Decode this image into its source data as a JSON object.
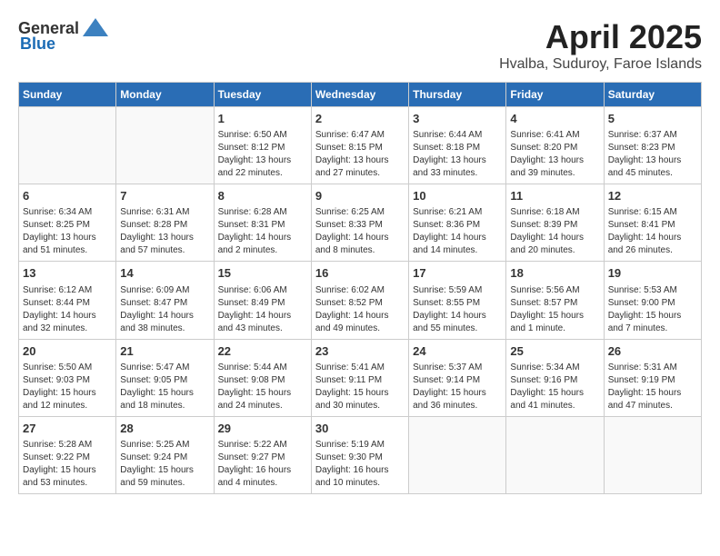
{
  "logo": {
    "general": "General",
    "blue": "Blue"
  },
  "title": "April 2025",
  "location": "Hvalba, Suduroy, Faroe Islands",
  "days_of_week": [
    "Sunday",
    "Monday",
    "Tuesday",
    "Wednesday",
    "Thursday",
    "Friday",
    "Saturday"
  ],
  "weeks": [
    [
      {
        "day": "",
        "sunrise": "",
        "sunset": "",
        "daylight": ""
      },
      {
        "day": "",
        "sunrise": "",
        "sunset": "",
        "daylight": ""
      },
      {
        "day": "1",
        "sunrise": "Sunrise: 6:50 AM",
        "sunset": "Sunset: 8:12 PM",
        "daylight": "Daylight: 13 hours and 22 minutes."
      },
      {
        "day": "2",
        "sunrise": "Sunrise: 6:47 AM",
        "sunset": "Sunset: 8:15 PM",
        "daylight": "Daylight: 13 hours and 27 minutes."
      },
      {
        "day": "3",
        "sunrise": "Sunrise: 6:44 AM",
        "sunset": "Sunset: 8:18 PM",
        "daylight": "Daylight: 13 hours and 33 minutes."
      },
      {
        "day": "4",
        "sunrise": "Sunrise: 6:41 AM",
        "sunset": "Sunset: 8:20 PM",
        "daylight": "Daylight: 13 hours and 39 minutes."
      },
      {
        "day": "5",
        "sunrise": "Sunrise: 6:37 AM",
        "sunset": "Sunset: 8:23 PM",
        "daylight": "Daylight: 13 hours and 45 minutes."
      }
    ],
    [
      {
        "day": "6",
        "sunrise": "Sunrise: 6:34 AM",
        "sunset": "Sunset: 8:25 PM",
        "daylight": "Daylight: 13 hours and 51 minutes."
      },
      {
        "day": "7",
        "sunrise": "Sunrise: 6:31 AM",
        "sunset": "Sunset: 8:28 PM",
        "daylight": "Daylight: 13 hours and 57 minutes."
      },
      {
        "day": "8",
        "sunrise": "Sunrise: 6:28 AM",
        "sunset": "Sunset: 8:31 PM",
        "daylight": "Daylight: 14 hours and 2 minutes."
      },
      {
        "day": "9",
        "sunrise": "Sunrise: 6:25 AM",
        "sunset": "Sunset: 8:33 PM",
        "daylight": "Daylight: 14 hours and 8 minutes."
      },
      {
        "day": "10",
        "sunrise": "Sunrise: 6:21 AM",
        "sunset": "Sunset: 8:36 PM",
        "daylight": "Daylight: 14 hours and 14 minutes."
      },
      {
        "day": "11",
        "sunrise": "Sunrise: 6:18 AM",
        "sunset": "Sunset: 8:39 PM",
        "daylight": "Daylight: 14 hours and 20 minutes."
      },
      {
        "day": "12",
        "sunrise": "Sunrise: 6:15 AM",
        "sunset": "Sunset: 8:41 PM",
        "daylight": "Daylight: 14 hours and 26 minutes."
      }
    ],
    [
      {
        "day": "13",
        "sunrise": "Sunrise: 6:12 AM",
        "sunset": "Sunset: 8:44 PM",
        "daylight": "Daylight: 14 hours and 32 minutes."
      },
      {
        "day": "14",
        "sunrise": "Sunrise: 6:09 AM",
        "sunset": "Sunset: 8:47 PM",
        "daylight": "Daylight: 14 hours and 38 minutes."
      },
      {
        "day": "15",
        "sunrise": "Sunrise: 6:06 AM",
        "sunset": "Sunset: 8:49 PM",
        "daylight": "Daylight: 14 hours and 43 minutes."
      },
      {
        "day": "16",
        "sunrise": "Sunrise: 6:02 AM",
        "sunset": "Sunset: 8:52 PM",
        "daylight": "Daylight: 14 hours and 49 minutes."
      },
      {
        "day": "17",
        "sunrise": "Sunrise: 5:59 AM",
        "sunset": "Sunset: 8:55 PM",
        "daylight": "Daylight: 14 hours and 55 minutes."
      },
      {
        "day": "18",
        "sunrise": "Sunrise: 5:56 AM",
        "sunset": "Sunset: 8:57 PM",
        "daylight": "Daylight: 15 hours and 1 minute."
      },
      {
        "day": "19",
        "sunrise": "Sunrise: 5:53 AM",
        "sunset": "Sunset: 9:00 PM",
        "daylight": "Daylight: 15 hours and 7 minutes."
      }
    ],
    [
      {
        "day": "20",
        "sunrise": "Sunrise: 5:50 AM",
        "sunset": "Sunset: 9:03 PM",
        "daylight": "Daylight: 15 hours and 12 minutes."
      },
      {
        "day": "21",
        "sunrise": "Sunrise: 5:47 AM",
        "sunset": "Sunset: 9:05 PM",
        "daylight": "Daylight: 15 hours and 18 minutes."
      },
      {
        "day": "22",
        "sunrise": "Sunrise: 5:44 AM",
        "sunset": "Sunset: 9:08 PM",
        "daylight": "Daylight: 15 hours and 24 minutes."
      },
      {
        "day": "23",
        "sunrise": "Sunrise: 5:41 AM",
        "sunset": "Sunset: 9:11 PM",
        "daylight": "Daylight: 15 hours and 30 minutes."
      },
      {
        "day": "24",
        "sunrise": "Sunrise: 5:37 AM",
        "sunset": "Sunset: 9:14 PM",
        "daylight": "Daylight: 15 hours and 36 minutes."
      },
      {
        "day": "25",
        "sunrise": "Sunrise: 5:34 AM",
        "sunset": "Sunset: 9:16 PM",
        "daylight": "Daylight: 15 hours and 41 minutes."
      },
      {
        "day": "26",
        "sunrise": "Sunrise: 5:31 AM",
        "sunset": "Sunset: 9:19 PM",
        "daylight": "Daylight: 15 hours and 47 minutes."
      }
    ],
    [
      {
        "day": "27",
        "sunrise": "Sunrise: 5:28 AM",
        "sunset": "Sunset: 9:22 PM",
        "daylight": "Daylight: 15 hours and 53 minutes."
      },
      {
        "day": "28",
        "sunrise": "Sunrise: 5:25 AM",
        "sunset": "Sunset: 9:24 PM",
        "daylight": "Daylight: 15 hours and 59 minutes."
      },
      {
        "day": "29",
        "sunrise": "Sunrise: 5:22 AM",
        "sunset": "Sunset: 9:27 PM",
        "daylight": "Daylight: 16 hours and 4 minutes."
      },
      {
        "day": "30",
        "sunrise": "Sunrise: 5:19 AM",
        "sunset": "Sunset: 9:30 PM",
        "daylight": "Daylight: 16 hours and 10 minutes."
      },
      {
        "day": "",
        "sunrise": "",
        "sunset": "",
        "daylight": ""
      },
      {
        "day": "",
        "sunrise": "",
        "sunset": "",
        "daylight": ""
      },
      {
        "day": "",
        "sunrise": "",
        "sunset": "",
        "daylight": ""
      }
    ]
  ]
}
